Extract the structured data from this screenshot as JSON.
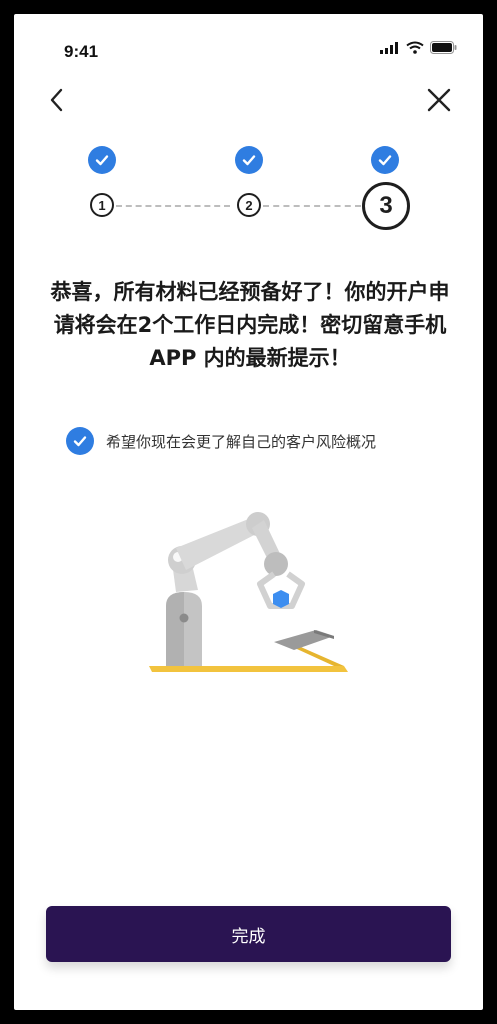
{
  "status_bar": {
    "time": "9:41"
  },
  "stepper": {
    "step1": "1",
    "step2": "2",
    "step3": "3"
  },
  "headline": "恭喜，所有材料已经预备好了！你的开户申请将会在2个工作日内完成！密切留意手机 APP 内的最新提示！",
  "wish": {
    "label": "希望你现在会更了解自己的客户风险概况",
    "checked": true
  },
  "done_button": {
    "label": "完成"
  },
  "colors": {
    "accent": "#2f7de1",
    "button_bg": "#2a1452"
  }
}
